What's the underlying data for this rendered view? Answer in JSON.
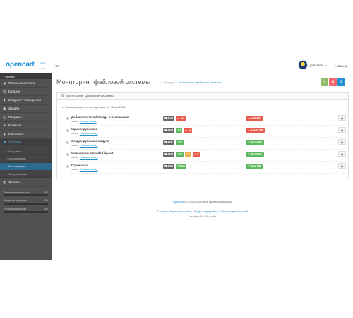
{
  "header": {
    "logo_text": "opencart",
    "logo_sub": "PRO",
    "logo_dots": "•••",
    "menu_icon": "bars-icon",
    "user_name": "john Doe",
    "user_caret": "▾",
    "logout_label": "Выход"
  },
  "sidebar": {
    "heading": "МЕНЮ",
    "items": [
      {
        "icon": "dashboard-icon",
        "glyph": "◉",
        "label": "Панель состояния",
        "arrow": ""
      },
      {
        "icon": "tags-icon",
        "glyph": "▤",
        "label": "Каталог",
        "arrow": "›"
      },
      {
        "icon": "puzzle-icon",
        "glyph": "✚",
        "label": "Модули / Расширения",
        "arrow": "›"
      },
      {
        "icon": "design-icon",
        "glyph": "▣",
        "label": "Дизайн",
        "arrow": "›"
      },
      {
        "icon": "cart-icon",
        "glyph": "◫",
        "label": "Продажи",
        "arrow": "›"
      },
      {
        "icon": "user-icon",
        "glyph": "●",
        "label": "Клиенты",
        "arrow": "›"
      },
      {
        "icon": "share-icon",
        "glyph": "◆",
        "label": "Маркетинг",
        "arrow": "›"
      },
      {
        "icon": "cog-icon",
        "glyph": "✱",
        "label": "Система",
        "arrow": "⌄"
      }
    ],
    "subitems": [
      {
        "label": "› Настройки"
      },
      {
        "label": "› Пользователи"
      },
      {
        "label": "› Локализация"
      },
      {
        "label": "› Обслуживание"
      }
    ],
    "reports": {
      "icon": "chart-icon",
      "glyph": "▥",
      "label": "Отчеты",
      "arrow": "›"
    },
    "stats": [
      {
        "label": "Заказы завершенные",
        "value": "0%",
        "fill": 0
      },
      {
        "label": "Заказы в процессе",
        "value": "0%",
        "fill": 0
      },
      {
        "label": "Остальные заказы",
        "value": "0%",
        "fill": 0
      }
    ]
  },
  "page": {
    "title": "Мониторинг файловой системы",
    "breadcrumb": [
      {
        "label": "⌂"
      },
      {
        "label": "›"
      },
      {
        "label": "Модули"
      },
      {
        "label": "›"
      },
      {
        "label": "Мониторинг файловой системы"
      }
    ],
    "buttons": [
      {
        "icon": "plus-icon",
        "glyph": "+"
      },
      {
        "icon": "trash-icon",
        "glyph": "✖"
      },
      {
        "icon": "settings-icon",
        "glyph": "⚙"
      }
    ]
  },
  "panel": {
    "icon": "list-icon",
    "glyph": "☰",
    "title": "Мониторинг файловой системы",
    "scan_icon": "calendar-icon",
    "scan_glyph": "⌄",
    "scan_text": "Сканирование на понедельник 07. Июнь 2021",
    "entries": [
      {
        "title": "Добавил system/storage в исключение",
        "user": "admin",
        "time": "8 минут назад",
        "tags": [
          {
            "class": "grey",
            "text": "▤ 3724"
          },
          {
            "class": "red",
            "text": "— 114"
          }
        ],
        "size": {
          "class": "red",
          "text": "— 1.08 MB"
        }
      },
      {
        "title": "Удалил дубликат",
        "user": "admin",
        "time": "16 минут назад",
        "tags": [
          {
            "class": "grey",
            "text": "▤ 3838"
          },
          {
            "class": "green",
            "text": "+ 2"
          },
          {
            "class": "red",
            "text": "— 11"
          }
        ],
        "size": {
          "class": "red",
          "text": "— 218.09 KB"
        }
      },
      {
        "title": "Создал дубликат модуля",
        "user": "admin",
        "time": "17 минут назад",
        "tags": [
          {
            "class": "grey",
            "text": "▤ 3847"
          },
          {
            "class": "green",
            "text": "+ 11"
          }
        ],
        "size": {
          "class": "green",
          "text": "+ 238.33 KB"
        }
      },
      {
        "title": "Установлен Extended layout",
        "user": "admin",
        "time": "18 минут назад",
        "tags": [
          {
            "class": "grey",
            "text": "▤ 3836"
          },
          {
            "class": "green",
            "text": "+ 12"
          },
          {
            "class": "orange",
            "text": "~ 1"
          },
          {
            "class": "red",
            "text": "— 0"
          }
        ],
        "size": {
          "class": "green",
          "text": "+ 234.65 KB"
        }
      },
      {
        "title": "Первичное",
        "user": "admin",
        "time": "31 минут назад",
        "tags": [
          {
            "class": "grey",
            "text": "▤ 3848"
          },
          {
            "class": "green",
            "text": "+ 3848"
          }
        ],
        "size": {
          "class": "green",
          "text": "+ 48.32 MB"
        }
      }
    ],
    "view_glyph": "◉",
    "meta_suffix": ","
  },
  "footer": {
    "copyright_brand": "OpenCart",
    "copyright_rest": "© 2009-2021 Все права защищены.",
    "links": [
      "Русская сборка Opencart",
      "Форум поддержки",
      "Магазин дополнений"
    ],
    "version": "Version 2.0.3.7 (rs.1)"
  }
}
